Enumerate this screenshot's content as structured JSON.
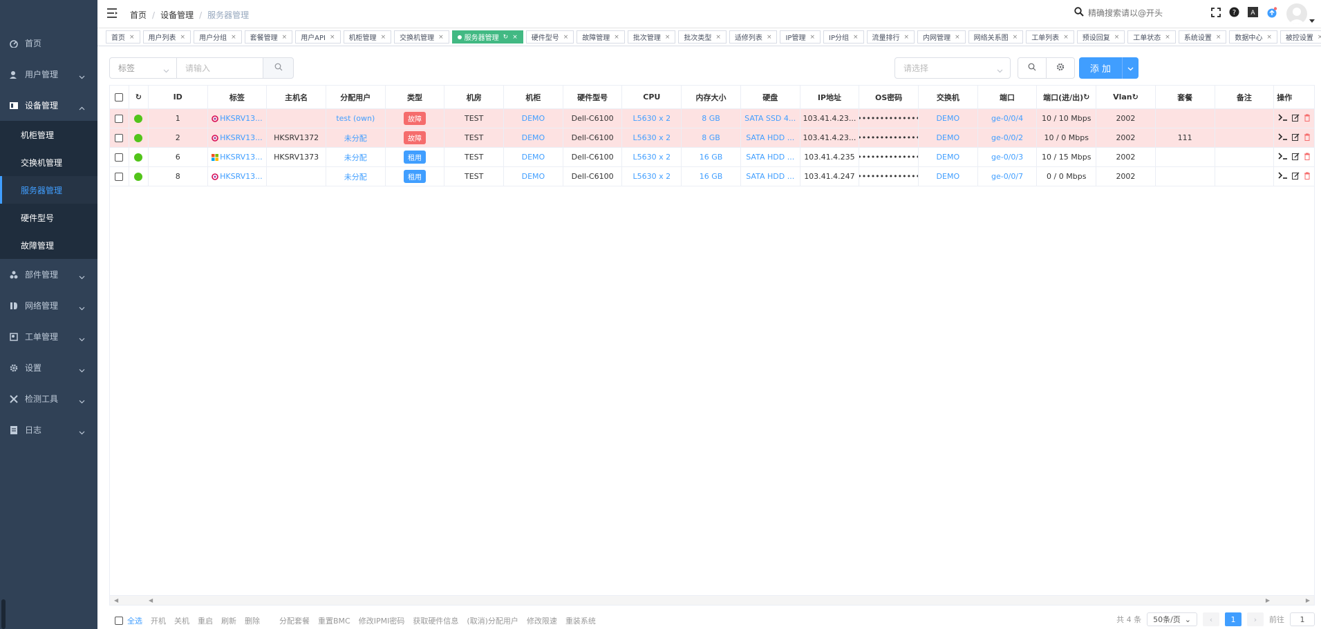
{
  "sidebar": {
    "items": [
      {
        "label": "首页",
        "icon": "dashboard-icon"
      },
      {
        "label": "用户管理",
        "icon": "user-icon"
      },
      {
        "label": "设备管理",
        "icon": "device-icon"
      },
      {
        "label": "部件管理",
        "icon": "component-icon"
      },
      {
        "label": "网络管理",
        "icon": "network-icon"
      },
      {
        "label": "工单管理",
        "icon": "ticket-icon"
      },
      {
        "label": "设置",
        "icon": "gear-icon"
      },
      {
        "label": "检测工具",
        "icon": "tools-icon"
      },
      {
        "label": "日志",
        "icon": "log-icon"
      }
    ],
    "sub_items": [
      "机柜管理",
      "交换机管理",
      "服务器管理",
      "硬件型号",
      "故障管理"
    ]
  },
  "header": {
    "breadcrumb": [
      "首页",
      "设备管理",
      "服务器管理"
    ],
    "search_placeholder": "精确搜索请以@开头"
  },
  "tags": [
    "首页",
    "用户列表",
    "用户分组",
    "套餐管理",
    "用户API",
    "机柜管理",
    "交换机管理",
    "服务器管理",
    "硬件型号",
    "故障管理",
    "批次管理",
    "批次类型",
    "适修列表",
    "IP管理",
    "IP分组",
    "流量排行",
    "内网管理",
    "网络关系图",
    "工单列表",
    "预设回复",
    "工单状态",
    "系统设置",
    "数据中心",
    "被控设置"
  ],
  "active_tag": "服务器管理",
  "toolbar": {
    "filter_select": "标签",
    "search_placeholder": "请输入",
    "right_select_placeholder": "请选择",
    "add_label": "添 加"
  },
  "table": {
    "headers": [
      "ID",
      "标签",
      "主机名",
      "分配用户",
      "类型",
      "机房",
      "机柜",
      "硬件型号",
      "CPU",
      "内存大小",
      "硬盘",
      "IP地址",
      "OS密码",
      "交换机",
      "端口",
      "端口(进/出)",
      "Vlan",
      "套餐",
      "备注",
      "操作"
    ],
    "rows": [
      {
        "id": "1",
        "tag": "HKSRV13...",
        "host": "",
        "user": "test (own)",
        "type": "故障",
        "type_color": "red",
        "room": "TEST",
        "rack": "DEMO",
        "model": "Dell-C6100",
        "cpu": "L5630 x 2",
        "mem": "8 GB",
        "disk": "SATA SSD 4...",
        "ip": "103.41.4.23...",
        "os": "••••••••••••••••",
        "switch": "DEMO",
        "port": "ge-0/0/4",
        "traffic": "10 / 10 Mbps",
        "vlan": "2002",
        "plan": "",
        "note": "",
        "fault": true,
        "os_icon": "debian-icon"
      },
      {
        "id": "2",
        "tag": "HKSRV13...",
        "host": "HKSRV1372",
        "user": "未分配",
        "type": "故障",
        "type_color": "red",
        "room": "TEST",
        "rack": "DEMO",
        "model": "Dell-C6100",
        "cpu": "L5630 x 2",
        "mem": "8 GB",
        "disk": "SATA HDD ...",
        "ip": "103.41.4.23...",
        "os": "••••••••••••••••",
        "switch": "DEMO",
        "port": "ge-0/0/2",
        "traffic": "10 / 0 Mbps",
        "vlan": "2002",
        "plan": "111",
        "note": "",
        "fault": true,
        "os_icon": "debian-icon"
      },
      {
        "id": "6",
        "tag": "HKSRV13...",
        "host": "HKSRV1373",
        "user": "未分配",
        "type": "租用",
        "type_color": "blue",
        "room": "TEST",
        "rack": "DEMO",
        "model": "Dell-C6100",
        "cpu": "L5630 x 2",
        "mem": "16 GB",
        "disk": "SATA HDD ...",
        "ip": "103.41.4.235",
        "os": "••••••••••••••••",
        "switch": "DEMO",
        "port": "ge-0/0/3",
        "traffic": "10 / 15 Mbps",
        "vlan": "2002",
        "plan": "",
        "note": "",
        "fault": false,
        "os_icon": "windows-icon"
      },
      {
        "id": "8",
        "tag": "HKSRV13...",
        "host": "",
        "user": "未分配",
        "type": "租用",
        "type_color": "blue",
        "room": "TEST",
        "rack": "DEMO",
        "model": "Dell-C6100",
        "cpu": "L5630 x 2",
        "mem": "16 GB",
        "disk": "SATA HDD ...",
        "ip": "103.41.4.247",
        "os": "••••••••••••••••",
        "switch": "DEMO",
        "port": "ge-0/0/7",
        "traffic": "0 / 0 Mbps",
        "vlan": "2002",
        "plan": "",
        "note": "",
        "fault": false,
        "os_icon": "debian-icon"
      }
    ]
  },
  "footer": {
    "actions": [
      "全选",
      "开机",
      "关机",
      "重启",
      "刷新",
      "删除",
      "分配套餐",
      "重置BMC",
      "修改IPMI密码",
      "获取硬件信息",
      "(取消)分配用户",
      "修改限速",
      "重装系统"
    ],
    "total": "共 4 条",
    "page_size": "50条/页",
    "current_page": "1",
    "goto_label": "前往",
    "goto_value": "1"
  },
  "colors": {
    "sidebar_bg": "#304156",
    "accent": "#409eff",
    "active_tag": "#42b983",
    "fault_row": "#fde2e2",
    "status_ok": "#52c41a"
  }
}
